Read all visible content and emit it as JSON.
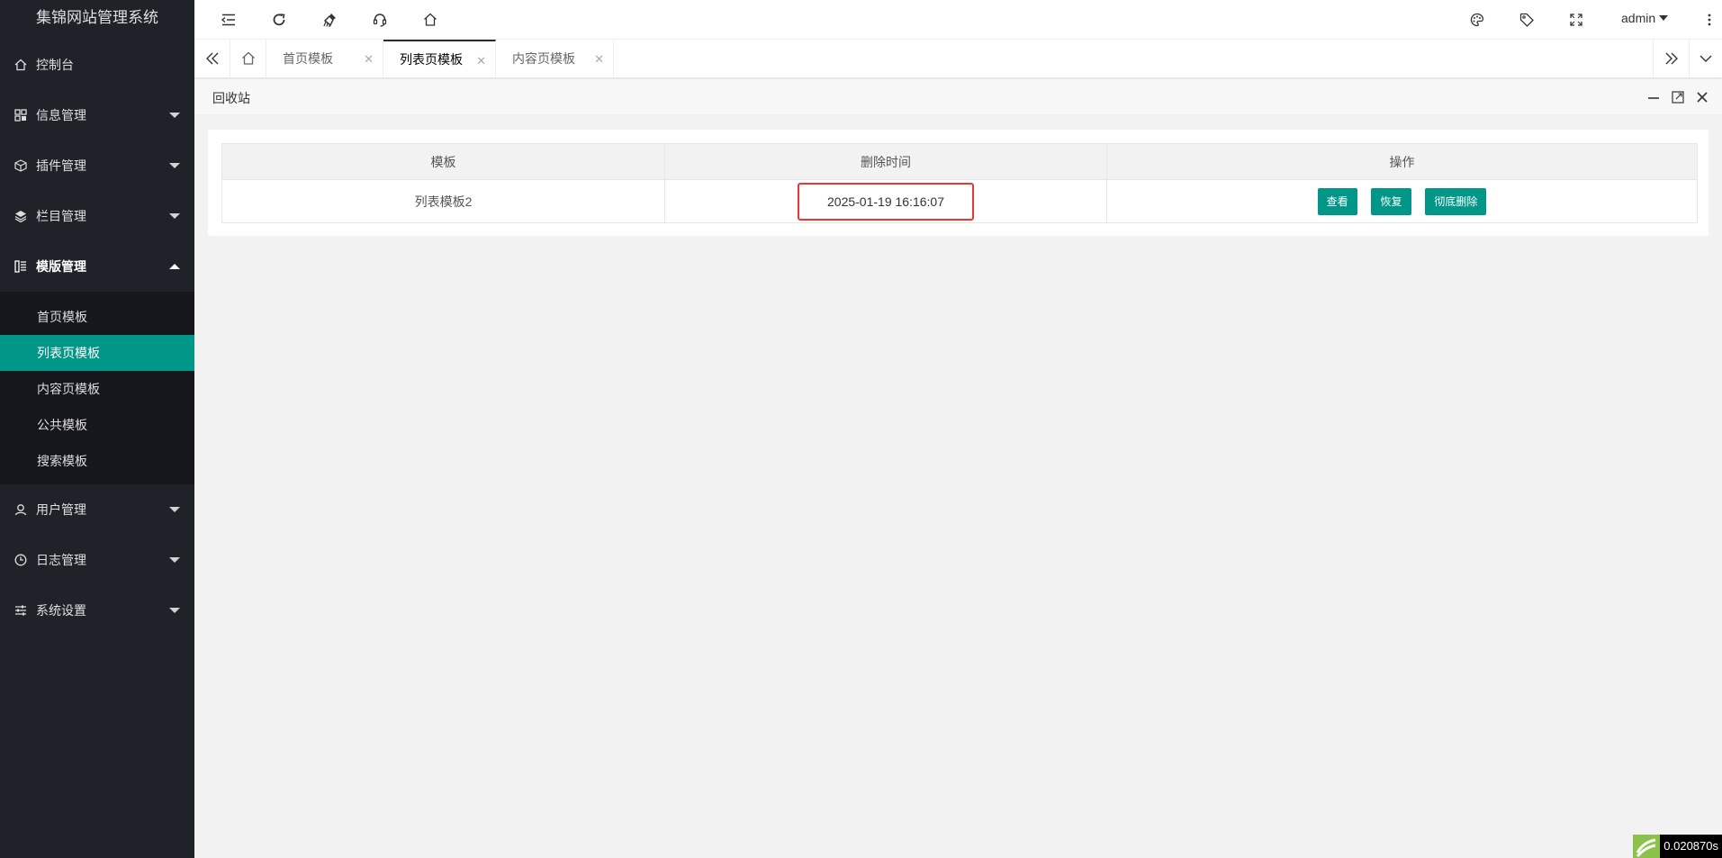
{
  "app": {
    "title": "集锦网站管理系统"
  },
  "sidebar": {
    "items": [
      {
        "label": "控制台",
        "icon": "home-icon"
      },
      {
        "label": "信息管理",
        "icon": "grid-icon"
      },
      {
        "label": "插件管理",
        "icon": "cube-icon"
      },
      {
        "label": "栏目管理",
        "icon": "layers-icon"
      },
      {
        "label": "模版管理",
        "icon": "template-icon"
      },
      {
        "label": "用户管理",
        "icon": "user-icon"
      },
      {
        "label": "日志管理",
        "icon": "clock-icon"
      },
      {
        "label": "系统设置",
        "icon": "sliders-icon"
      }
    ],
    "sub_items": [
      "首页模板",
      "列表页模板",
      "内容页模板",
      "公共模板",
      "搜索模板"
    ]
  },
  "header": {
    "user": "admin"
  },
  "tabs": [
    {
      "label": "首页模板"
    },
    {
      "label": "列表页模板"
    },
    {
      "label": "内容页模板"
    }
  ],
  "panel": {
    "title": "回收站"
  },
  "table": {
    "headers": [
      "模板",
      "删除时间",
      "操作"
    ],
    "rows": [
      {
        "name": "列表模板2",
        "deleted_at": "2025-01-19 16:16:07"
      }
    ],
    "actions": {
      "view": "查看",
      "restore": "恢复",
      "delete": "彻底删除"
    }
  },
  "footer": {
    "timer": "0.020870s"
  },
  "colors": {
    "accent": "#009688",
    "sidebar_bg": "#20222a",
    "highlight": "#e53935"
  }
}
